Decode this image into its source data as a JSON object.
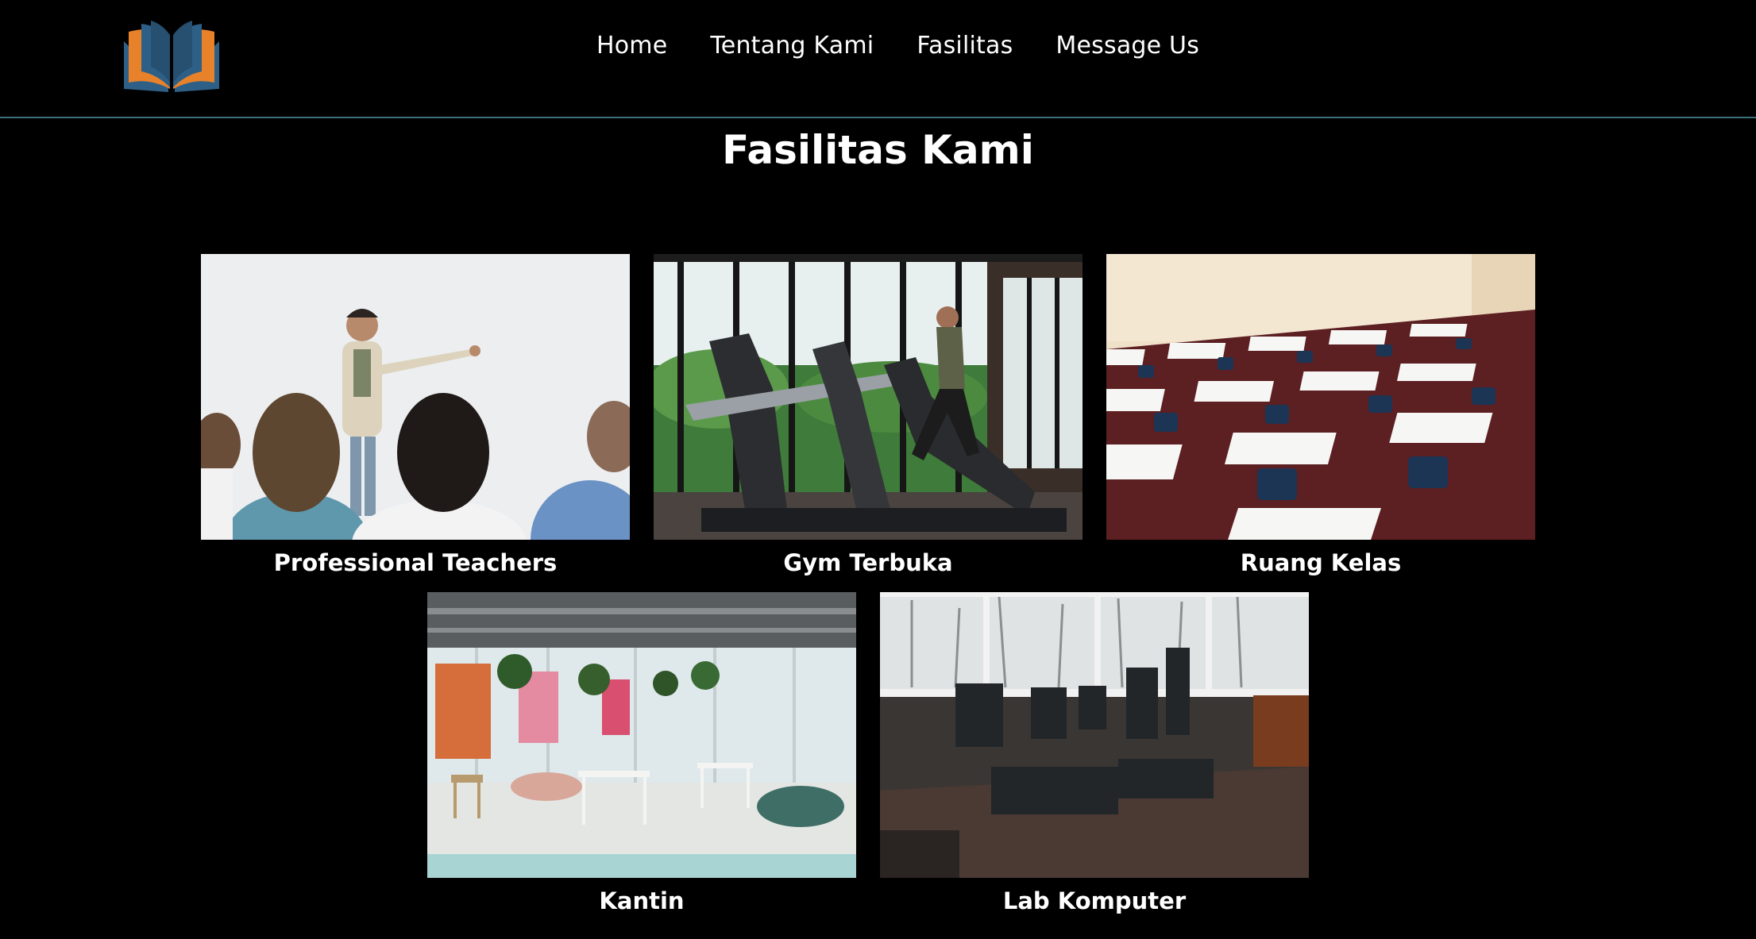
{
  "nav": {
    "logo": "open-book-logo",
    "links": [
      "Home",
      "Tentang Kami",
      "Fasilitas",
      "Message Us"
    ]
  },
  "page_title": "Fasilitas Kami",
  "facilities": [
    {
      "caption": "Professional Teachers",
      "image": "classroom-teacher-photo"
    },
    {
      "caption": "Gym Terbuka",
      "image": "gym-treadmill-photo"
    },
    {
      "caption": "Ruang Kelas",
      "image": "empty-classroom-desks-photo"
    },
    {
      "caption": "Kantin",
      "image": "cafeteria-photo"
    },
    {
      "caption": "Lab Komputer",
      "image": "computer-lab-photo"
    }
  ],
  "colors": {
    "background": "#000000",
    "divider": "#3b6e7a",
    "logo_orange": "#e8822a",
    "logo_blue": "#2e5f86"
  }
}
